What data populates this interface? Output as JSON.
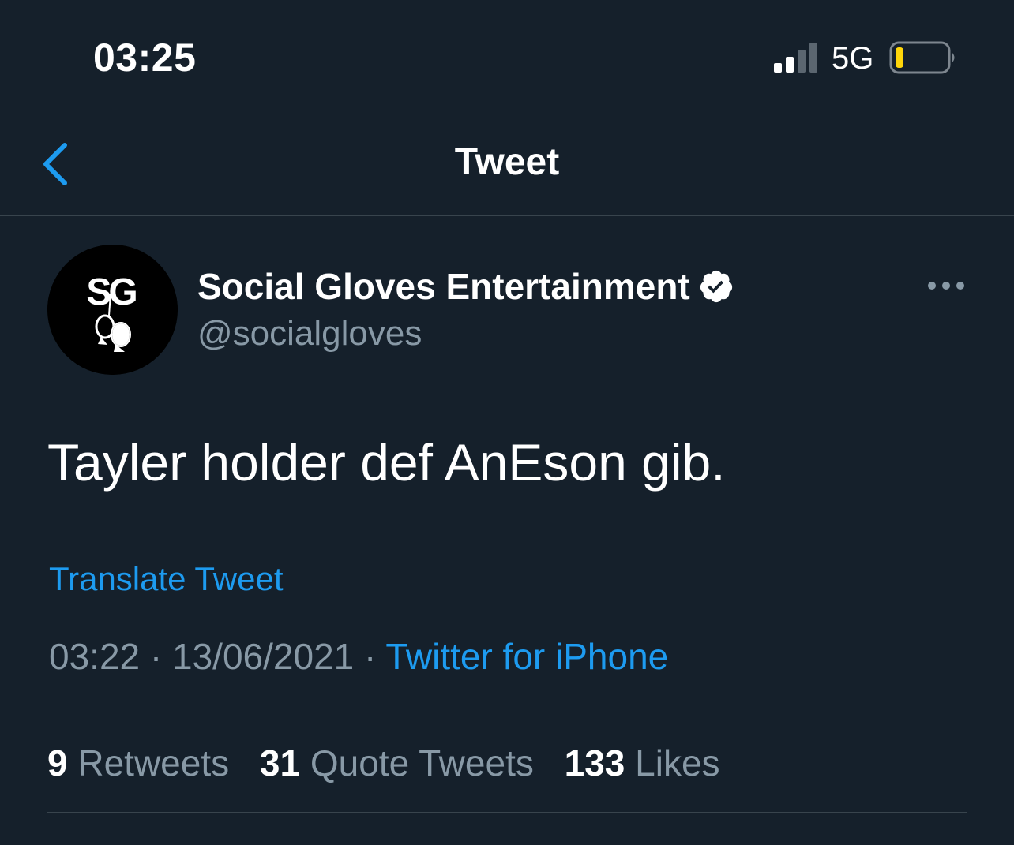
{
  "status_bar": {
    "time": "03:25",
    "network": "5G",
    "signal_icon": "signal-bars-icon",
    "battery_icon": "battery-low-icon",
    "battery_color": "#ffd60a"
  },
  "nav": {
    "title": "Tweet",
    "back_icon": "chevron-left-icon"
  },
  "tweet": {
    "avatar_text": "SG",
    "display_name": "Social Gloves Entertainment",
    "handle": "@socialgloves",
    "verified_icon": "verified-badge-icon",
    "more_icon": "more-horizontal-icon",
    "text": "Tayler holder def AnEson gib.",
    "translate_label": "Translate Tweet",
    "time": "03:22",
    "separator": "·",
    "date": "13/06/2021",
    "source": "Twitter for iPhone"
  },
  "stats": {
    "retweets_count": "9",
    "retweets_label": "Retweets",
    "quotes_count": "31",
    "quotes_label": "Quote Tweets",
    "likes_count": "133",
    "likes_label": "Likes"
  },
  "colors": {
    "background": "#15202b",
    "accent": "#1d9bf0",
    "secondary_text": "#8899a6",
    "divider": "#38444d"
  }
}
